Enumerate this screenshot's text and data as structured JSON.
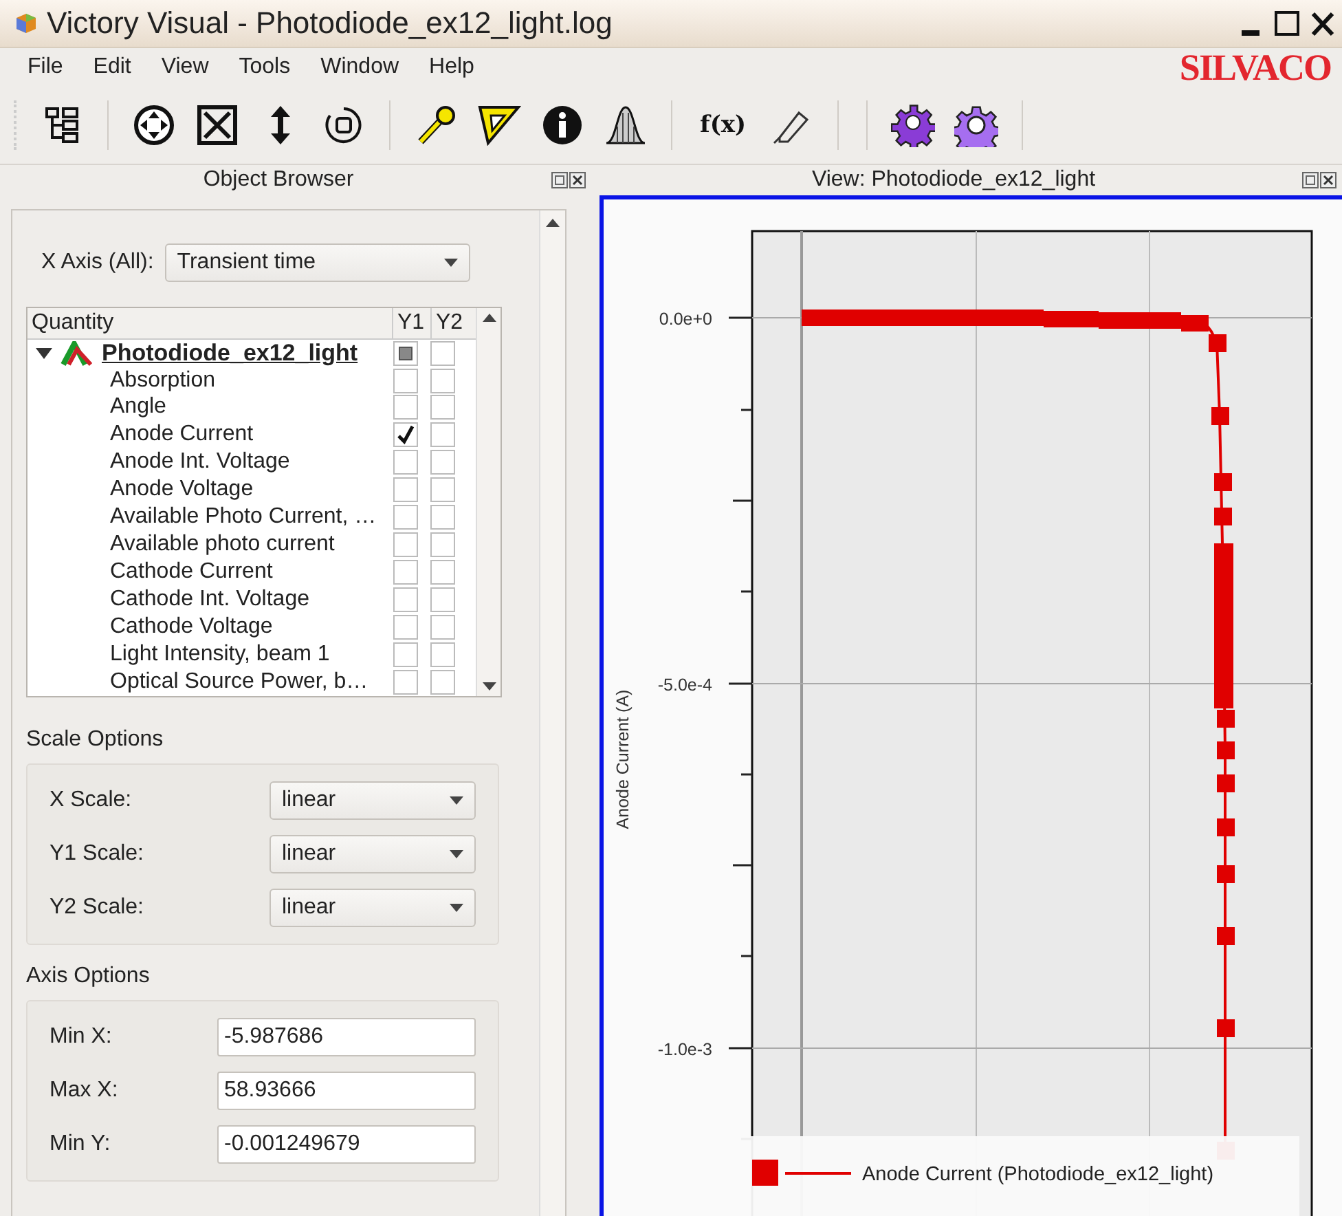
{
  "window": {
    "title": "Victory Visual - Photodiode_ex12_light.log"
  },
  "menu": [
    "File",
    "Edit",
    "View",
    "Tools",
    "Window",
    "Help"
  ],
  "logo": "SILVACO",
  "toolbar": {
    "function_button": "f(x)"
  },
  "object_browser": {
    "title": "Object Browser",
    "x_axis": {
      "label": "X Axis (All):",
      "value": "Transient time"
    },
    "table": {
      "columns": [
        "Quantity",
        "Y1",
        "Y2"
      ],
      "root": {
        "name": "Photodiode_ex12_light",
        "expanded": true,
        "y1_checked": false,
        "y1_partial": true,
        "y2_checked": false,
        "children": [
          {
            "name": "Absorption",
            "y1_checked": false,
            "y2_checked": false
          },
          {
            "name": "Angle",
            "y1_checked": false,
            "y2_checked": false
          },
          {
            "name": "Anode Current",
            "y1_checked": true,
            "y2_checked": false
          },
          {
            "name": "Anode Int. Voltage",
            "y1_checked": false,
            "y2_checked": false
          },
          {
            "name": "Anode Voltage",
            "y1_checked": false,
            "y2_checked": false
          },
          {
            "name": "Available Photo Current, …",
            "y1_checked": false,
            "y2_checked": false
          },
          {
            "name": "Available photo current",
            "y1_checked": false,
            "y2_checked": false
          },
          {
            "name": "Cathode Current",
            "y1_checked": false,
            "y2_checked": false
          },
          {
            "name": "Cathode Int. Voltage",
            "y1_checked": false,
            "y2_checked": false
          },
          {
            "name": "Cathode Voltage",
            "y1_checked": false,
            "y2_checked": false
          },
          {
            "name": "Light Intensity, beam 1",
            "y1_checked": false,
            "y2_checked": false
          },
          {
            "name": "Optical Source Power, b…",
            "y1_checked": false,
            "y2_checked": false
          }
        ]
      }
    },
    "scale_options": {
      "title": "Scale Options",
      "rows": [
        {
          "label": "X Scale:",
          "value": "linear"
        },
        {
          "label": "Y1 Scale:",
          "value": "linear"
        },
        {
          "label": "Y2 Scale:",
          "value": "linear"
        }
      ]
    },
    "axis_options": {
      "title": "Axis Options",
      "rows": [
        {
          "label": "Min X:",
          "value": "-5.987686"
        },
        {
          "label": "Max X:",
          "value": "58.93666"
        },
        {
          "label": "Min Y:",
          "value": "-0.001249679"
        }
      ]
    }
  },
  "view": {
    "title": "View: Photodiode_ex12_light",
    "y_label": "Anode Current (A)",
    "y_ticks": [
      "0.0e+0",
      "-5.0e-4",
      "-1.0e-3"
    ],
    "legend": "Anode Current (Photodiode_ex12_light)"
  }
}
